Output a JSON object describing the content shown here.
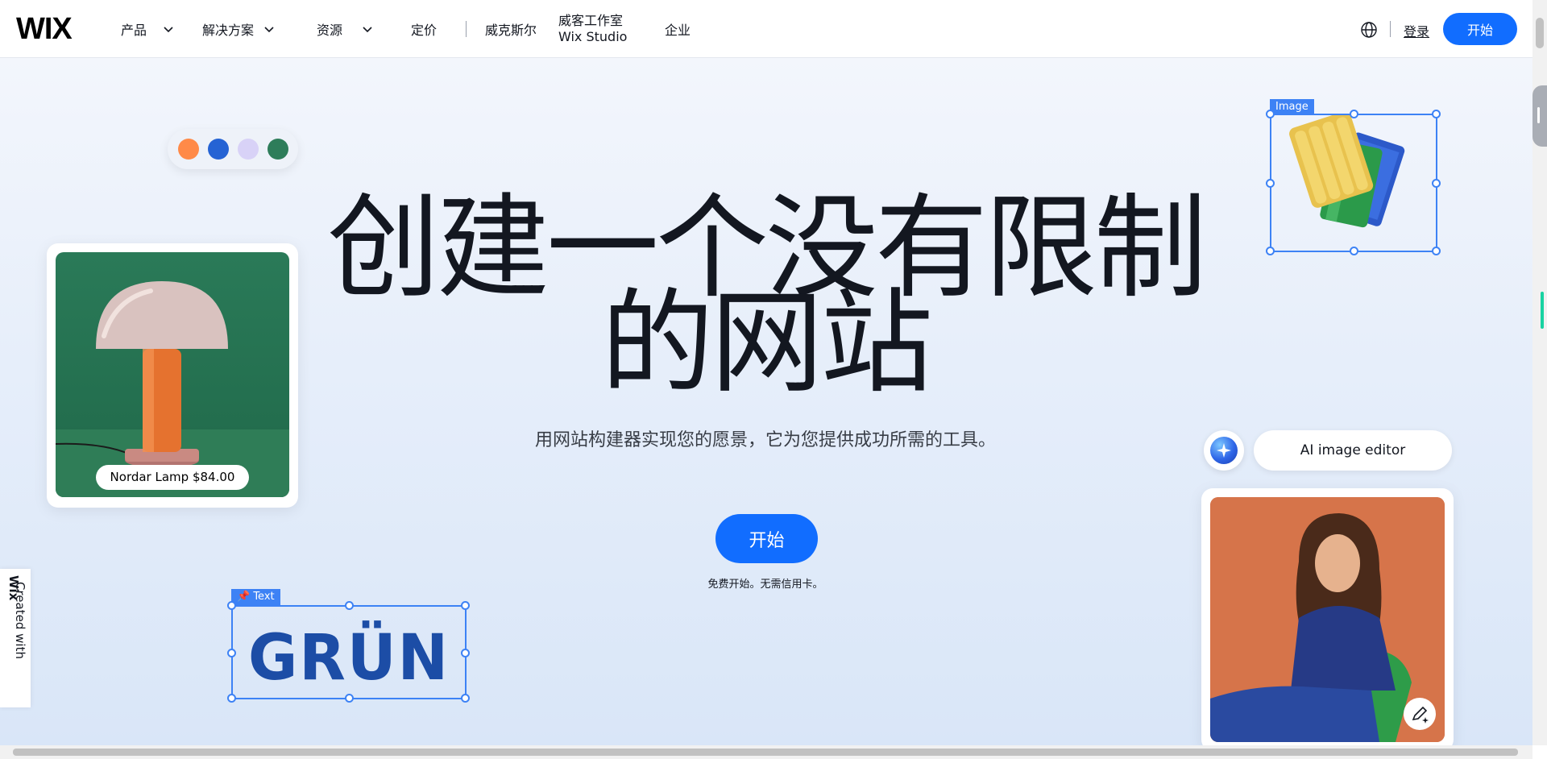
{
  "nav": {
    "logo": "WIX",
    "items": [
      {
        "label": "产品"
      },
      {
        "label": "解决方案"
      },
      {
        "label": "资源"
      },
      {
        "label": "定价"
      },
      {
        "label": "威克斯尔"
      },
      {
        "label_line1": "威客工作室",
        "label_line2": "Wix Studio"
      },
      {
        "label": "企业"
      }
    ],
    "login": "登录",
    "cta": "开始"
  },
  "hero": {
    "title_line1": "创建一个没有限制",
    "title_line2": "的网站",
    "subtitle": "用网站构建器实现您的愿景，它为您提供成功所需的工具。",
    "cta": "开始",
    "note": "免费开始。无需信用卡。"
  },
  "swatches": [
    "#ff8a48",
    "#2563d4",
    "#d8d2f7",
    "#2e7d5a"
  ],
  "lamp_card": {
    "price_label": "Nordar Lamp $84.00"
  },
  "image_selection": {
    "tag": "Image"
  },
  "text_selection": {
    "tag": "Text",
    "sample": "GRÜN"
  },
  "ai_editor": {
    "label": "AI image editor"
  },
  "created_with": {
    "prefix": "Created with ",
    "brand": "Wix"
  },
  "colors": {
    "accent": "#116dff",
    "selection": "#3d82f5"
  }
}
